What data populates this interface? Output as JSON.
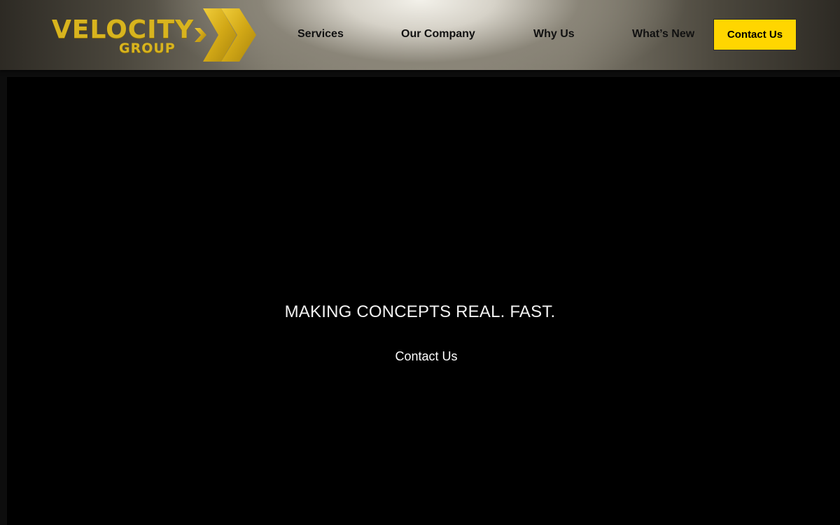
{
  "header": {
    "logo": {
      "main_text": "VELOCITY",
      "sub_text": "GROUP"
    },
    "nav": [
      {
        "label": "Services"
      },
      {
        "label": "Our Company"
      },
      {
        "label": "Why Us"
      },
      {
        "label": "What’s New"
      }
    ],
    "contact_button": "Contact Us"
  },
  "hero": {
    "title": "MAKING CONCEPTS REAL. FAST.",
    "link": "Contact Us"
  },
  "colors": {
    "accent_yellow": "#ffd600",
    "logo_gold": "#d8b41e",
    "hero_background": "#000000"
  },
  "icons": {
    "logo_mark": "double-chevron-right-icon"
  }
}
